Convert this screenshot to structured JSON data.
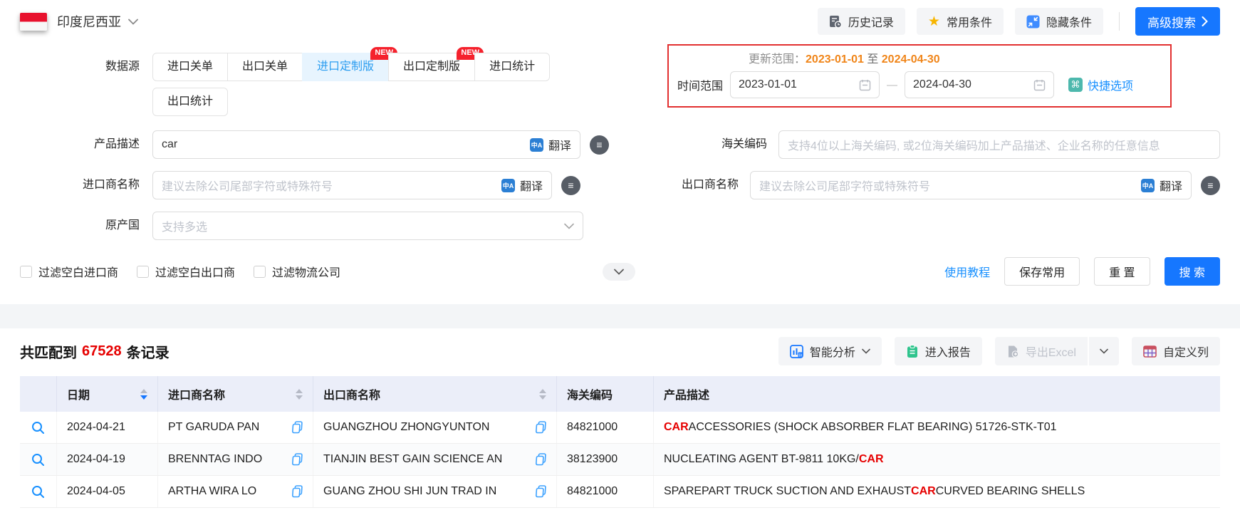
{
  "icons": {
    "star": "★",
    "command": "⌘",
    "translate_glyph": "中A",
    "logic_glyph": "≡"
  },
  "colors": {
    "primary_blue": "#1677ff",
    "link_blue": "#1890ff",
    "selected_tab_bg": "#e7f4fe",
    "selected_tab_text": "#2b9df0",
    "badge_red": "#f5222d",
    "alert_border_red": "#e23030",
    "highlight_red": "#e60000",
    "orange_date": "#f08519",
    "teal_icon": "#4db8ad",
    "green_icon": "#2fc48d",
    "table_header_bg": "#ebeef9",
    "flag_red": "#e8112d"
  },
  "topbar": {
    "country": "印度尼西亚",
    "history_label": "历史记录",
    "favorites_label": "常用条件",
    "hide_label": "隐藏条件",
    "advanced_label": "高级搜索"
  },
  "form": {
    "datasource_label": "数据源",
    "tabs": [
      {
        "label": "进口关单",
        "selected": false,
        "badge": ""
      },
      {
        "label": "出口关单",
        "selected": false,
        "badge": ""
      },
      {
        "label": "进口定制版",
        "selected": true,
        "badge": "NEW"
      },
      {
        "label": "出口定制版",
        "selected": false,
        "badge": "NEW"
      },
      {
        "label": "进口统计",
        "selected": false,
        "badge": ""
      },
      {
        "label": "出口统计",
        "selected": false,
        "badge": ""
      }
    ],
    "update_range": {
      "label": "更新范围：",
      "start": "2023-01-01",
      "to": "至",
      "end": "2024-04-30"
    },
    "time_range": {
      "label": "时间范围",
      "start": "2023-01-01",
      "separator": "—",
      "end": "2024-04-30",
      "quick_label": "快捷选项"
    },
    "product_desc": {
      "label": "产品描述",
      "value": "car",
      "translate_label": "翻译"
    },
    "hs_code": {
      "label": "海关编码",
      "placeholder": "支持4位以上海关编码, 或2位海关编码加上产品描述、企业名称的任意信息"
    },
    "importer": {
      "label": "进口商名称",
      "placeholder": "建议去除公司尾部字符或特殊符号",
      "translate_label": "翻译"
    },
    "exporter": {
      "label": "出口商名称",
      "placeholder": "建议去除公司尾部字符或特殊符号",
      "translate_label": "翻译"
    },
    "origin": {
      "label": "原产国",
      "placeholder": "支持多选"
    },
    "checkboxes": [
      {
        "label": "过滤空白进口商",
        "checked": false
      },
      {
        "label": "过滤空白出口商",
        "checked": false
      },
      {
        "label": "过滤物流公司",
        "checked": false
      }
    ],
    "tutorial_label": "使用教程",
    "save_label": "保存常用",
    "reset_label": "重 置",
    "search_label": "搜 索"
  },
  "results": {
    "summary_prefix": "共匹配到",
    "count": "67528",
    "summary_suffix": "条记录",
    "analysis_label": "智能分析",
    "report_label": "进入报告",
    "export_label": "导出Excel",
    "custom_columns_label": "自定义列",
    "table": {
      "columns": [
        {
          "label": "日期",
          "sort": "desc"
        },
        {
          "label": "进口商名称",
          "sort": "none"
        },
        {
          "label": "出口商名称",
          "sort": "none"
        },
        {
          "label": "海关编码",
          "sort": ""
        },
        {
          "label": "产品描述",
          "sort": ""
        }
      ],
      "rows": [
        {
          "date": "2024-04-21",
          "importer": "PT GARUDA PAN",
          "exporter": "GUANGZHOU ZHONGYUNTON",
          "hs_code": "84821000",
          "description": [
            [
              "CAR",
              true
            ],
            [
              " ACCESSORIES (SHOCK ABSORBER FLAT BEARING) 51726-STK-T01",
              false
            ]
          ]
        },
        {
          "date": "2024-04-19",
          "importer": "BRENNTAG INDO",
          "exporter": "TIANJIN BEST GAIN SCIENCE AN",
          "hs_code": "38123900",
          "description": [
            [
              "NUCLEATING AGENT BT-9811 10KG/",
              false
            ],
            [
              "CAR",
              true
            ]
          ]
        },
        {
          "date": "2024-04-05",
          "importer": "ARTHA WIRA LO",
          "exporter": "GUANG ZHOU SHI JUN TRAD IN",
          "hs_code": "84821000",
          "description": [
            [
              "SPAREPART TRUCK SUCTION AND EXHAUST ",
              false
            ],
            [
              "CAR",
              true
            ],
            [
              " CURVED BEARING SHELLS",
              false
            ]
          ]
        }
      ]
    }
  }
}
